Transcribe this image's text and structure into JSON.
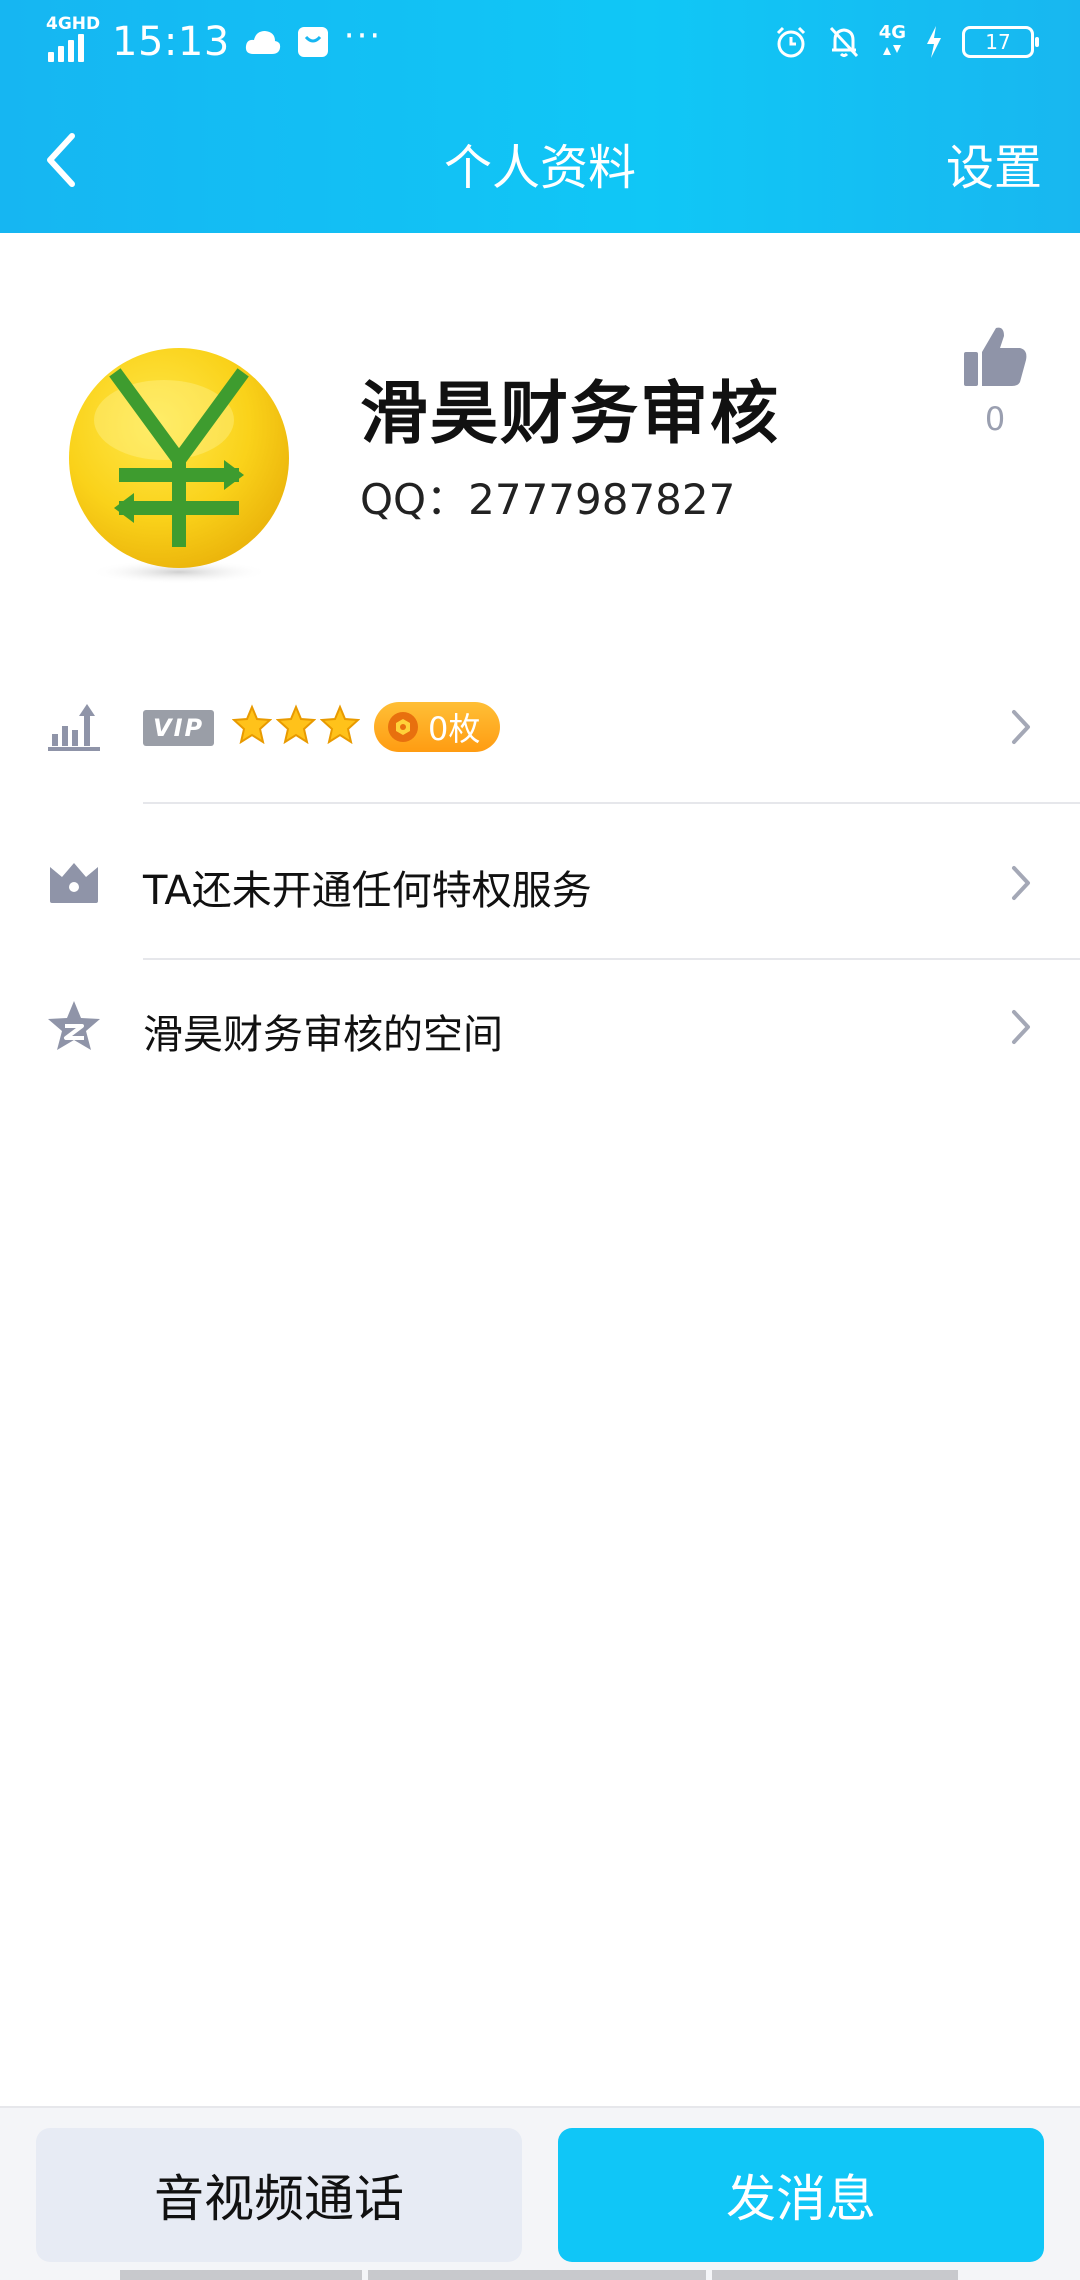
{
  "status_bar": {
    "network": "4GHD",
    "time": "15:13",
    "mobile_data": "4G",
    "more": "···",
    "battery": "17"
  },
  "nav": {
    "title": "个人资料",
    "settings_label": "设置"
  },
  "profile": {
    "name": "滑昊财务审核",
    "qq_label": "QQ：",
    "qq_number": "2777987827",
    "like_count": "0"
  },
  "rows": {
    "vip": {
      "vip_badge": "VIP",
      "star_count": 3,
      "coin_label": "0枚"
    },
    "privilege": {
      "label": "TA还未开通任何特权服务"
    },
    "space": {
      "label": "滑昊财务审核的空间"
    }
  },
  "actions": {
    "call_label": "音视频通话",
    "message_label": "发消息"
  },
  "colors": {
    "header": "#16b6f2",
    "primary_button": "#10c6f7",
    "secondary_button": "#e7ebf4",
    "coin_pill": "#ffa51f",
    "icon_gray": "#8f94a8"
  },
  "icons": {
    "back": "chevron-left-icon",
    "like": "thumbs-up-icon",
    "level": "level-up-icon",
    "privilege": "crown-box-icon",
    "space": "qzone-star-icon",
    "chevron": "chevron-right-icon",
    "avatar": "yuan-coin-icon"
  }
}
